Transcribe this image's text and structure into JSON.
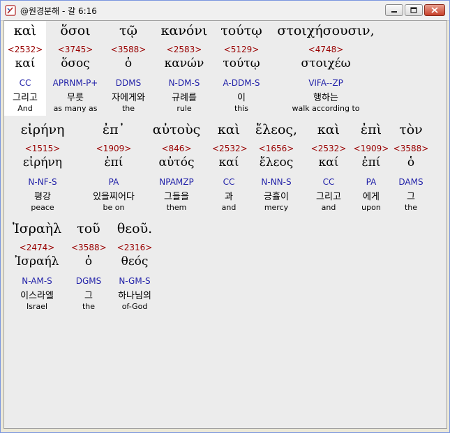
{
  "window": {
    "title": "@원경분해 - 갈 6:16",
    "minimize_label": "minimize",
    "maximize_label": "maximize",
    "close_label": "close"
  },
  "rows": [
    [
      {
        "greek": "καὶ",
        "strong": "<2532>",
        "lemma": "καί",
        "parsing": "CC",
        "korean": "그리고",
        "english": "And",
        "highlighted": true
      },
      {
        "greek": "ὅσοι",
        "strong": "<3745>",
        "lemma": "ὅσος",
        "parsing": "APRNM-P+",
        "korean": "무릇",
        "english": "as many as"
      },
      {
        "greek": "τῷ",
        "strong": "<3588>",
        "lemma": "ὁ",
        "parsing": "DDMS",
        "korean": "자에게와",
        "english": "the"
      },
      {
        "greek": "κανόνι",
        "strong": "<2583>",
        "lemma": "κανών",
        "parsing": "N-DM-S",
        "korean": "규례를",
        "english": "rule"
      },
      {
        "greek": "τούτῳ",
        "strong": "<5129>",
        "lemma": "τούτῳ",
        "parsing": "A-DDM-S",
        "korean": "이",
        "english": "this"
      },
      {
        "greek": "στοιχήσουσιν,",
        "strong": "<4748>",
        "lemma": "στοιχέω",
        "parsing": "VIFA--ZP",
        "korean": "행하는",
        "english": "walk according to"
      }
    ],
    [
      {
        "greek": "εἰρήνη",
        "strong": "<1515>",
        "lemma": "εἰρήνη",
        "parsing": "N-NF-S",
        "korean": "평강",
        "english": "peace"
      },
      {
        "greek": "ἐπ᾽",
        "strong": "<1909>",
        "lemma": "ἐπί",
        "parsing": "PA",
        "korean": "있을찌어다",
        "english": "be on"
      },
      {
        "greek": "αὐτοὺς",
        "strong": "<846>",
        "lemma": "αὐτός",
        "parsing": "NPAMZP",
        "korean": "그들을",
        "english": "them"
      },
      {
        "greek": "καὶ",
        "strong": "<2532>",
        "lemma": "καί",
        "parsing": "CC",
        "korean": "과",
        "english": "and"
      },
      {
        "greek": "ἔλεος,",
        "strong": "<1656>",
        "lemma": "ἔλεος",
        "parsing": "N-NN-S",
        "korean": "긍휼이",
        "english": "mercy"
      },
      {
        "greek": "καὶ",
        "strong": "<2532>",
        "lemma": "καί",
        "parsing": "CC",
        "korean": "그리고",
        "english": "and"
      },
      {
        "greek": "ἐπὶ",
        "strong": "<1909>",
        "lemma": "ἐπί",
        "parsing": "PA",
        "korean": "에게",
        "english": "upon"
      },
      {
        "greek": "τὸν",
        "strong": "<3588>",
        "lemma": "ὁ",
        "parsing": "DAMS",
        "korean": "그",
        "english": "the"
      }
    ],
    [
      {
        "greek": "Ἰσραὴλ",
        "strong": "<2474>",
        "lemma": "Ἰσραήλ",
        "parsing": "N-AM-S",
        "korean": "이스라엘",
        "english": "Israel"
      },
      {
        "greek": "τοῦ",
        "strong": "<3588>",
        "lemma": "ὁ",
        "parsing": "DGMS",
        "korean": "그",
        "english": "the"
      },
      {
        "greek": "θεοῦ.",
        "strong": "<2316>",
        "lemma": "θεός",
        "parsing": "N-GM-S",
        "korean": "하나님의",
        "english": "of-God"
      }
    ]
  ],
  "colors": {
    "strong_number": "#990000",
    "parsing_code": "#1f1fa8",
    "highlight": "#ffffff",
    "background": "#ececec"
  }
}
